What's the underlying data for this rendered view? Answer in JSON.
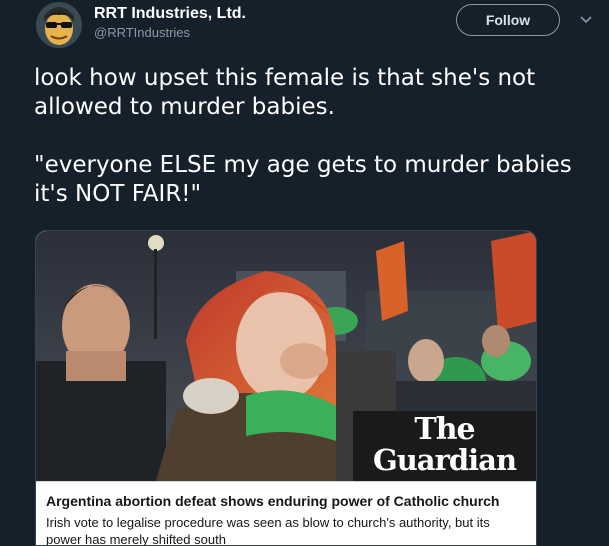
{
  "account": {
    "display_name": "RRT Industries, Ltd.",
    "handle": "@RRTIndustries",
    "avatar_icon": "avatar-cartoon-sunglasses-icon"
  },
  "actions": {
    "follow_label": "Follow",
    "menu_icon": "chevron-down-icon"
  },
  "tweet": {
    "text": "look how upset this female is that she's not allowed to murder babies.\n\n\"everyone ELSE my age gets to murder babies it's NOT FAIR!\""
  },
  "card": {
    "image_icon": "news-photo-crying-protester",
    "logo_line1": "The",
    "logo_line2": "Guardian",
    "title": "Argentina abortion defeat shows enduring power of Catholic church",
    "description": "Irish vote to legalise procedure was seen as blow to church's authority, but its power has merely shifted south"
  },
  "colors": {
    "background": "#15202b",
    "text_primary": "#ffffff",
    "text_secondary": "#8899a6",
    "border": "#38444d",
    "guardian_green": "#2ea44f"
  }
}
